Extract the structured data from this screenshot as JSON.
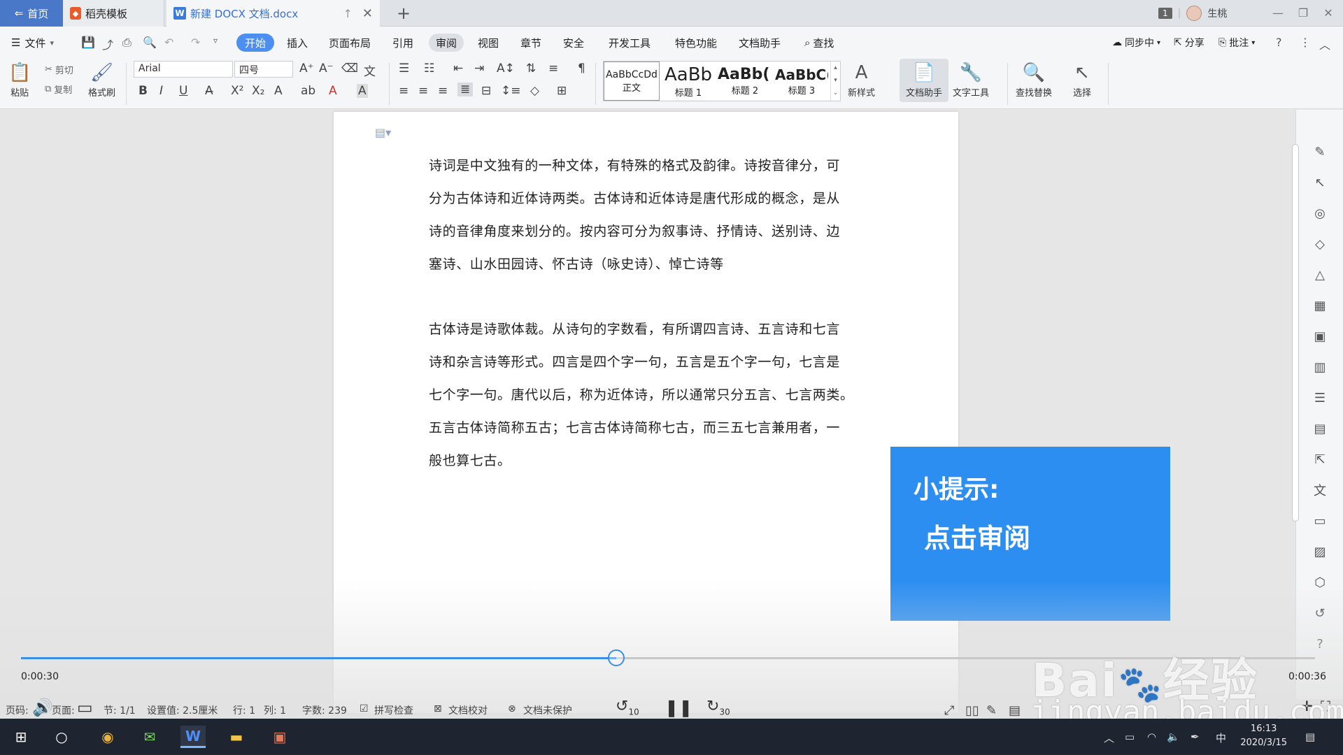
{
  "titlebar": {
    "home_tab": "首页",
    "template_tab": "稻壳模板",
    "doc_tab": "新建 DOCX 文档.docx",
    "badge": "1",
    "user": "生桃"
  },
  "menubar": {
    "file": "文件",
    "items": [
      "开始",
      "插入",
      "页面布局",
      "引用",
      "审阅",
      "视图",
      "章节",
      "安全",
      "开发工具",
      "特色功能",
      "文档助手"
    ],
    "search": "查找",
    "sync": "同步中",
    "share": "分享",
    "comment": "批注"
  },
  "ribbon": {
    "paste": "粘贴",
    "cut": "剪切",
    "copy": "复制",
    "format_painter": "格式刷",
    "font_name": "Arial",
    "font_size": "四号",
    "styles": [
      {
        "preview": "AaBbCcDd",
        "label": "正文"
      },
      {
        "preview": "AaBb",
        "label": "标题 1"
      },
      {
        "preview": "AaBb(",
        "label": "标题 2"
      },
      {
        "preview": "AaBbC(",
        "label": "标题 3"
      }
    ],
    "new_style": "新样式",
    "doc_assistant": "文档助手",
    "text_tools": "文字工具",
    "find_replace": "查找替换",
    "select": "选择"
  },
  "document": {
    "paragraphs": [
      [
        "诗词是中文独有的一种文体，有特殊的格式及韵律。诗按音律分，可",
        "分为古体诗和近体诗两类。古体诗和近体诗是唐代形成的概念，是从",
        "诗的音律角度来划分的。按内容可分为叙事诗、抒情诗、送别诗、边",
        "塞诗、山水田园诗、怀古诗（咏史诗）、悼亡诗等"
      ],
      [
        "古体诗是诗歌体裁。从诗句的字数看，有所谓四言诗、五言诗和七言",
        "诗和杂言诗等形式。四言是四个字一句，五言是五个字一句，七言是",
        "七个字一句。唐代以后，称为近体诗，所以通常只分五言、七言两类。",
        "五言古体诗简称五古；七言古体诗简称七古，而三五七言兼用者，一",
        "般也算七古。"
      ]
    ]
  },
  "tip": {
    "title": "小提示:",
    "body": "点击审阅"
  },
  "video": {
    "current_time": "0:00:30",
    "total_time": "0:00:36",
    "progress": 0.46,
    "skip_back": "10",
    "skip_forward": "30"
  },
  "statusbar": {
    "page_label": "页码:",
    "pages_label": "页面:",
    "section": "节: 1/1",
    "setting": "设置值: 2.5厘米",
    "row": "行: 1",
    "col": "列: 1",
    "word_count": "字数: 239",
    "spellcheck": "拼写检查",
    "proofread": "文档校对",
    "protection": "文档未保护"
  },
  "watermark": {
    "brand": "Bai",
    "brand2": "经验",
    "url": "jingyan.baidu.com"
  },
  "taskbar": {
    "time": "16:13",
    "date": "2020/3/15",
    "ime": "中"
  }
}
